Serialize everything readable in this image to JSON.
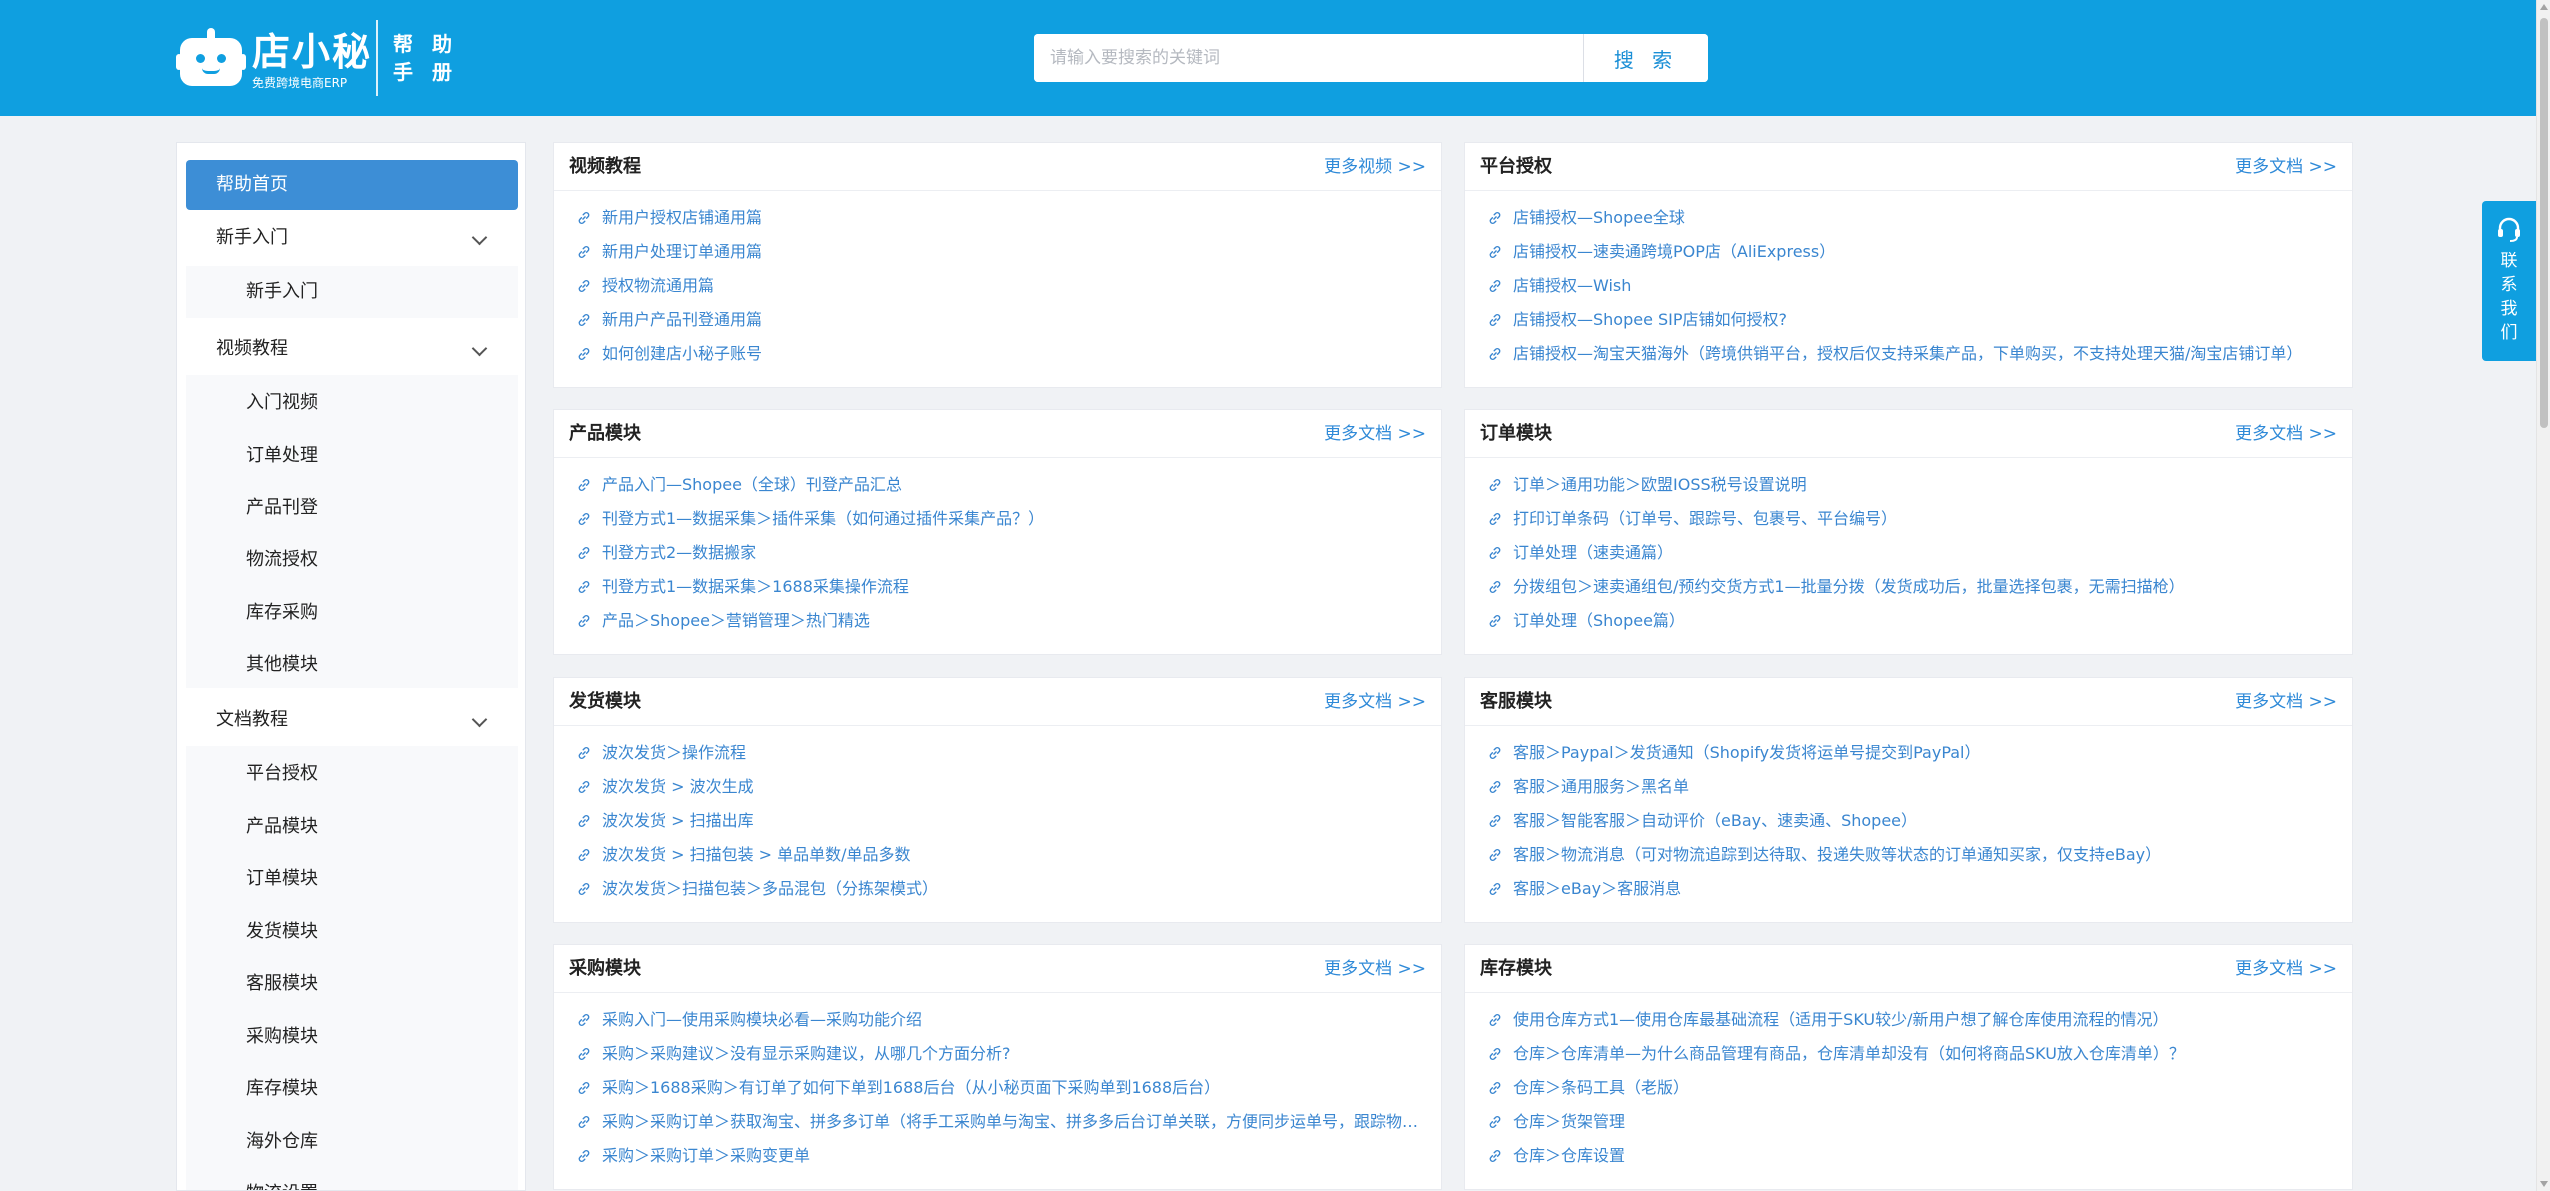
{
  "header": {
    "brand_name": "店小秘",
    "brand_slogan": "免费跨境电商ERP",
    "help_title_line1": "帮 助",
    "help_title_line2": "手 册",
    "search_placeholder": "请输入要搜索的关键词",
    "search_button": "搜 索"
  },
  "sidebar": {
    "home": "帮助首页",
    "groups": [
      {
        "label": "新手入门",
        "items": [
          "新手入门"
        ]
      },
      {
        "label": "视频教程",
        "items": [
          "入门视频",
          "订单处理",
          "产品刊登",
          "物流授权",
          "库存采购",
          "其他模块"
        ]
      },
      {
        "label": "文档教程",
        "items": [
          "平台授权",
          "产品模块",
          "订单模块",
          "发货模块",
          "客服模块",
          "采购模块",
          "库存模块",
          "海外仓库",
          "物流设置"
        ]
      }
    ]
  },
  "cards": [
    {
      "title": "视频教程",
      "more": "更多视频 >>",
      "items": [
        "新用户授权店铺通用篇",
        "新用户处理订单通用篇",
        "授权物流通用篇",
        "新用户产品刊登通用篇",
        "如何创建店小秘子账号"
      ]
    },
    {
      "title": "平台授权",
      "more": "更多文档 >>",
      "items": [
        "店铺授权—Shopee全球",
        "店铺授权—速卖通跨境POP店（AliExpress）",
        "店铺授权—Wish",
        "店铺授权—Shopee SIP店铺如何授权?",
        "店铺授权—淘宝天猫海外（跨境供销平台，授权后仅支持采集产品，下单购买，不支持处理天猫/淘宝店铺订单）"
      ]
    },
    {
      "title": "产品模块",
      "more": "更多文档 >>",
      "items": [
        "产品入门—Shopee（全球）刊登产品汇总",
        "刊登方式1—数据采集＞插件采集（如何通过插件采集产品？）",
        "刊登方式2—数据搬家",
        "刊登方式1—数据采集＞1688采集操作流程",
        "产品＞Shopee＞营销管理＞热门精选"
      ]
    },
    {
      "title": "订单模块",
      "more": "更多文档 >>",
      "items": [
        "订单＞通用功能＞欧盟IOSS税号设置说明",
        "打印订单条码（订单号、跟踪号、包裹号、平台编号）",
        "订单处理（速卖通篇）",
        "分拨组包＞速卖通组包/预约交货方式1—批量分拨（发货成功后，批量选择包裹，无需扫描枪）",
        "订单处理（Shopee篇）"
      ]
    },
    {
      "title": "发货模块",
      "more": "更多文档 >>",
      "items": [
        "波次发货＞操作流程",
        "波次发货 > 波次生成",
        "波次发货 > 扫描出库",
        "波次发货 > 扫描包装 > 单品单数/单品多数",
        "波次发货＞扫描包装＞多品混包（分拣架模式）"
      ]
    },
    {
      "title": "客服模块",
      "more": "更多文档 >>",
      "items": [
        "客服＞Paypal＞发货通知（Shopify发货将运单号提交到PayPal）",
        "客服＞通用服务＞黑名单",
        "客服＞智能客服＞自动评价（eBay、速卖通、Shopee）",
        "客服＞物流消息（可对物流追踪到达待取、投递失败等状态的订单通知买家，仅支持eBay）",
        "客服＞eBay＞客服消息"
      ]
    },
    {
      "title": "采购模块",
      "more": "更多文档 >>",
      "items": [
        "采购入门—使用采购模块必看—采购功能介绍",
        "采购＞采购建议＞没有显示采购建议，从哪几个方面分析?",
        "采购＞1688采购＞有订单了如何下单到1688后台（从小秘页面下采购单到1688后台）",
        "采购＞采购订单＞获取淘宝、拼多多订单（将手工采购单与淘宝、拼多多后台订单关联，方便同步运单号，跟踪物流）",
        "采购＞采购订单＞采购变更单"
      ]
    },
    {
      "title": "库存模块",
      "more": "更多文档 >>",
      "items": [
        "使用仓库方式1—使用仓库最基础流程（适用于SKU较少/新用户想了解仓库使用流程的情况）",
        "仓库＞仓库清单—为什么商品管理有商品，仓库清单却没有（如何将商品SKU放入仓库清单）？",
        "仓库＞条码工具（老版）",
        "仓库＞货架管理",
        "仓库＞仓库设置"
      ]
    }
  ],
  "contact": {
    "label": "联系我们"
  }
}
